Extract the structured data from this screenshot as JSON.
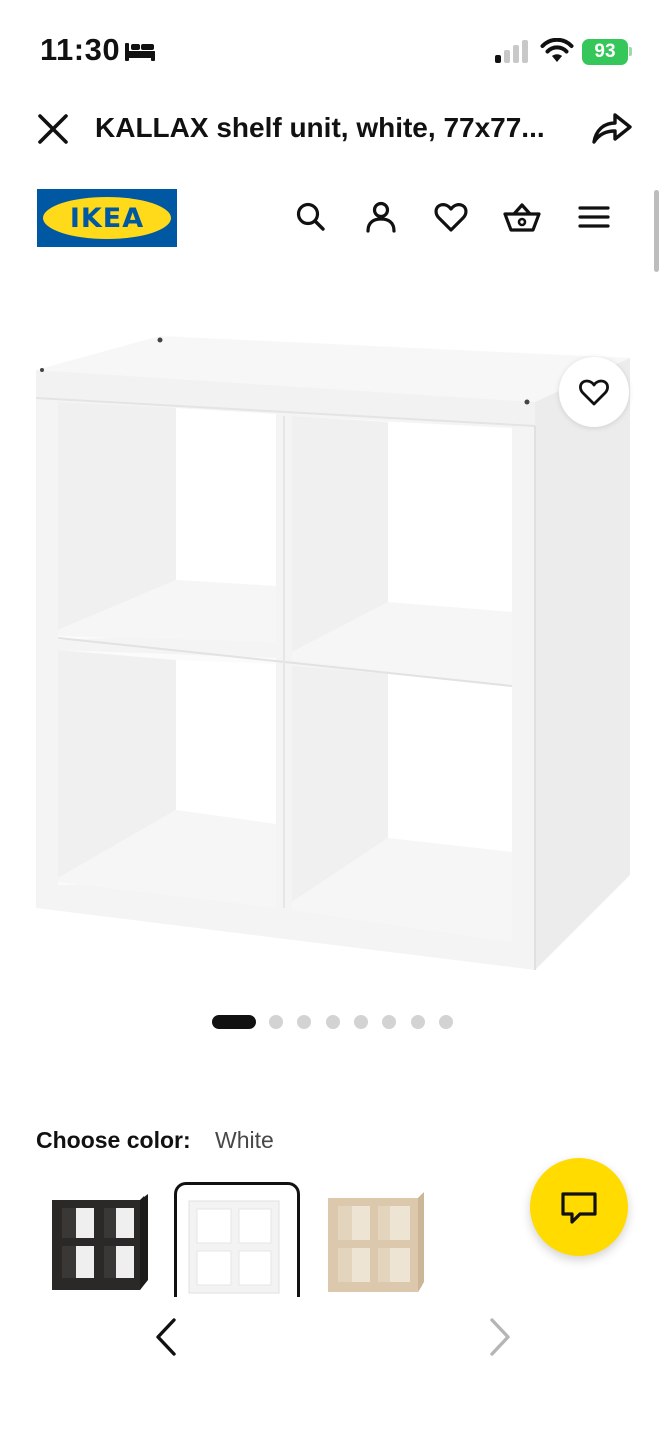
{
  "status_bar": {
    "time": "11:30",
    "battery": "93"
  },
  "browser_header": {
    "title": "KALLAX shelf unit, white, 77x77..."
  },
  "brand": {
    "logo_text": "IKEA",
    "colors": {
      "blue": "#0058a3",
      "yellow": "#ffda1a"
    }
  },
  "nav_icons": [
    "search-icon",
    "account-icon",
    "heart-icon",
    "basket-icon",
    "menu-icon"
  ],
  "gallery": {
    "image_count": 8,
    "active_index": 0
  },
  "color_chooser": {
    "label": "Choose color:",
    "selected": "White",
    "options": [
      "Black-brown",
      "White",
      "White stained oak effect"
    ]
  },
  "chat": {
    "icon": "chat-icon",
    "color": "#ffdb00"
  }
}
